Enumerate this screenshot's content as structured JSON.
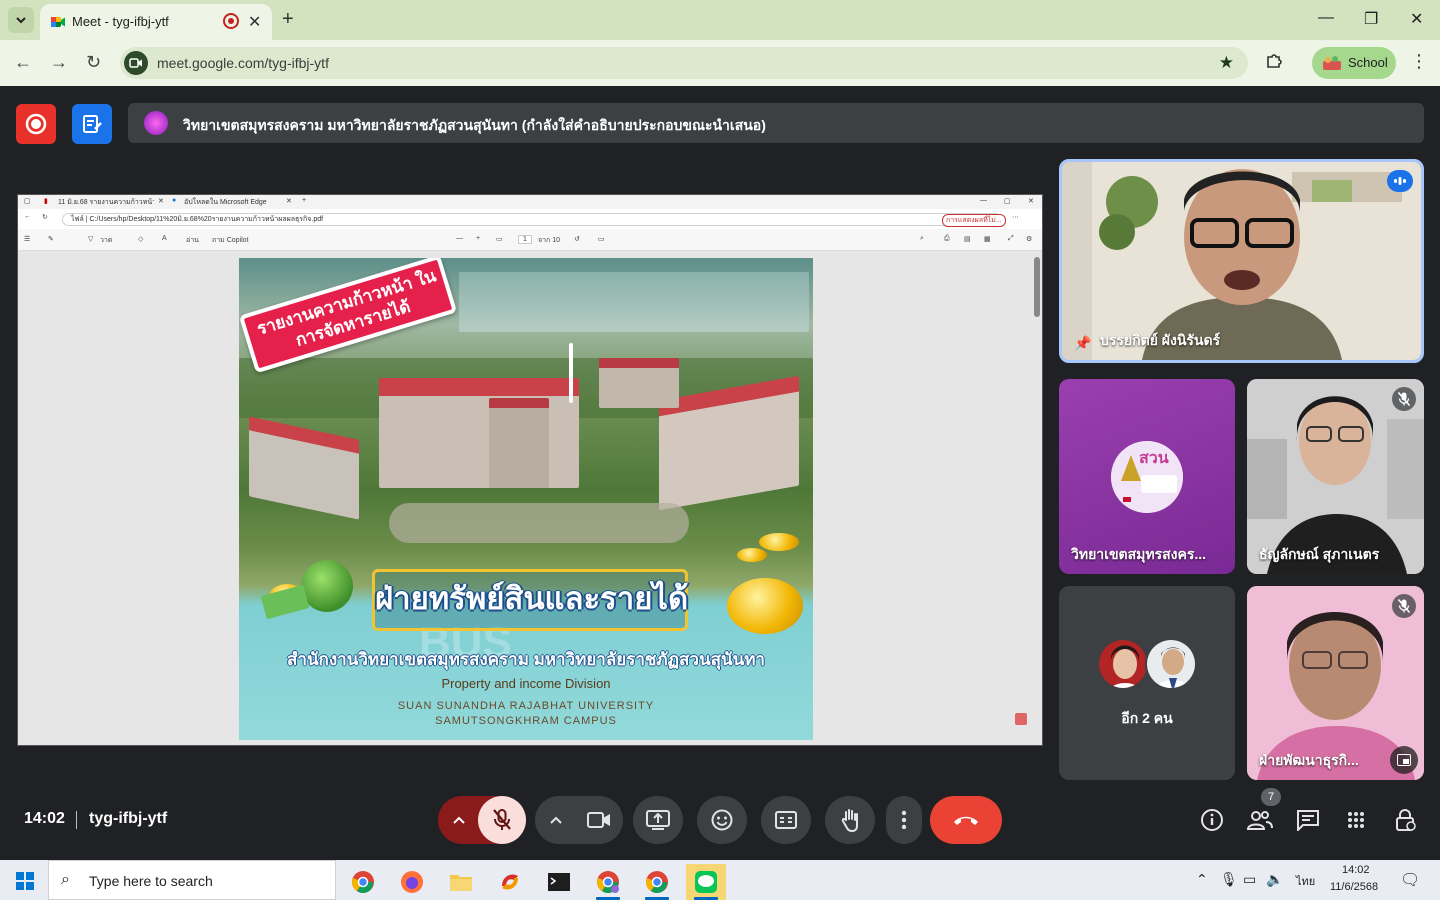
{
  "browser": {
    "tab_title": "Meet - tyg-ifbj-ytf",
    "url": "meet.google.com/tyg-ifbj-ytf",
    "profile_label": "School"
  },
  "meet": {
    "caption": "วิทยาเขตสมุทรสงคราม มหาวิทยาลัยราชภัฏสวนสุนันทา (กำลังใส่คำอธิบายประกอบขณะนำเสนอ)",
    "time": "14:02",
    "code": "tyg-ifbj-ytf",
    "participant_count": "7",
    "tiles": {
      "main_name": "บรรยกิตย์ ผังนิรันดร์",
      "org_name": "วิทยาเขตสมุทรสงคร...",
      "p2_name": "ธัญลักษณ์ สุภาเนตร",
      "more_label": "อีก 2 คน",
      "p3_name": "ฝ่ายพัฒนาธุรกิ..."
    }
  },
  "shared_screen": {
    "tab1": "11 มิ.ย.68 รายงานความก้าวหน้าผลผ...",
    "tab2": "อัปโหลดใน Microsoft Edge",
    "url": "C:/Users/hp/Desktop/11%20มิ.ย.68%20รายงานความก้าวหน้าผลผลธุรกิจ.pdf",
    "file_label": "ไฟล์",
    "copilot_label": "ถาม Copilot",
    "page_number": "1",
    "page_total": "จาก 10",
    "account_chip": "การแสดงผลที่ไม่...",
    "draw_label": "วาด",
    "read_label": "อ่าน",
    "poster": {
      "ribbon": "รายงานความก้าวหน้า ในการจัดหารายได้",
      "title": "ฝ่ายทรัพย์สินและรายได้",
      "subtitle_th": "สำนักงานวิทยาเขตสมุทรสงคราม มหาวิทยาลัยราชภัฏสวนสุนันทา",
      "subtitle_en": "Property and income Division",
      "university_line1": "SUAN SUNANDHA RAJABHAT UNIVERSITY",
      "university_line2": "SAMUTSONGKHRAM CAMPUS",
      "bg_word": "BUS"
    }
  },
  "taskbar": {
    "search_placeholder": "Type here to search",
    "lang": "ไทย",
    "time": "14:02",
    "date": "11/6/2568"
  },
  "colors": {
    "meet_bg": "#202124",
    "leave_red": "#ea4335",
    "record_red": "#e8312a",
    "notes_blue": "#1a73e8",
    "chrome_tab_green": "#d3e3c0",
    "speaker_outline": "#a8c7fa"
  }
}
